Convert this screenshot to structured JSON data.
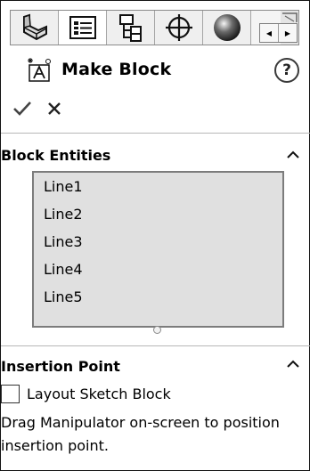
{
  "toolbar": {
    "tabs": [
      {
        "icon": "feature-manager-icon"
      },
      {
        "icon": "property-manager-icon"
      },
      {
        "icon": "configuration-manager-icon"
      },
      {
        "icon": "dim-xpert-icon"
      },
      {
        "icon": "display-manager-icon"
      }
    ],
    "scroll_left": "◀",
    "scroll_right": "▶"
  },
  "panel": {
    "title": "Make Block",
    "help_label": "?",
    "ok_label": "✓",
    "cancel_label": "✕"
  },
  "block_entities": {
    "title": "Block Entities",
    "items": [
      "Line1",
      "Line2",
      "Line3",
      "Line4",
      "Line5"
    ]
  },
  "insertion_point": {
    "title": "Insertion Point",
    "checkbox_label": "Layout Sketch Block",
    "checkbox_checked": false,
    "hint": "Drag Manipulator on-screen to position insertion point."
  }
}
